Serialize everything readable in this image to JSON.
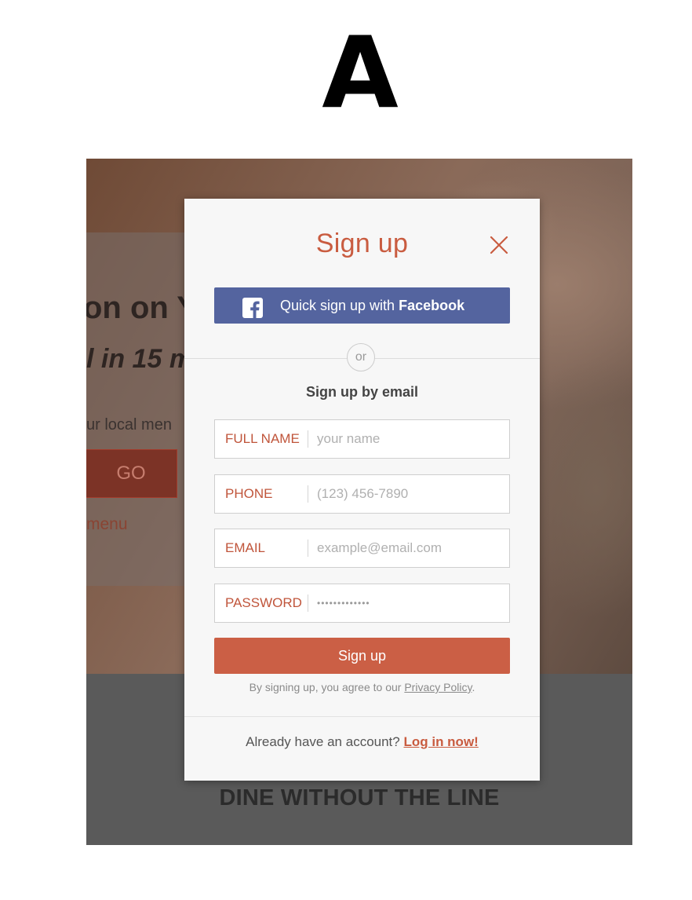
{
  "figure_label": "A",
  "background": {
    "headline": "on on Y",
    "subline": "l in 15 m",
    "hint": "ur local men",
    "go_button": "GO",
    "menu_link": "menu",
    "footer_title": "DINE WITHOUT THE LINE"
  },
  "modal": {
    "title": "Sign up",
    "close_icon": "close-icon",
    "facebook_button": {
      "icon": "facebook-icon",
      "label_prefix": "Quick sign up with ",
      "label_brand": "Facebook"
    },
    "divider_text": "or",
    "email_heading": "Sign up by email",
    "fields": {
      "full_name": {
        "label": "FULL NAME",
        "placeholder": "your name"
      },
      "phone": {
        "label": "PHONE",
        "placeholder": "(123) 456-7890"
      },
      "email": {
        "label": "EMAIL",
        "placeholder": "example@email.com"
      },
      "password": {
        "label": "PASSWORD",
        "value": "•••••••••••••"
      }
    },
    "signup_button": "Sign up",
    "terms_prefix": "By signing up, you agree to our ",
    "terms_link": "Privacy Policy",
    "terms_suffix": ".",
    "login_prompt": "Already have an account? ",
    "login_link": "Log in now!"
  },
  "colors": {
    "accent": "#c95c40",
    "facebook": "#54649f",
    "modal_bg": "#f7f7f7"
  }
}
